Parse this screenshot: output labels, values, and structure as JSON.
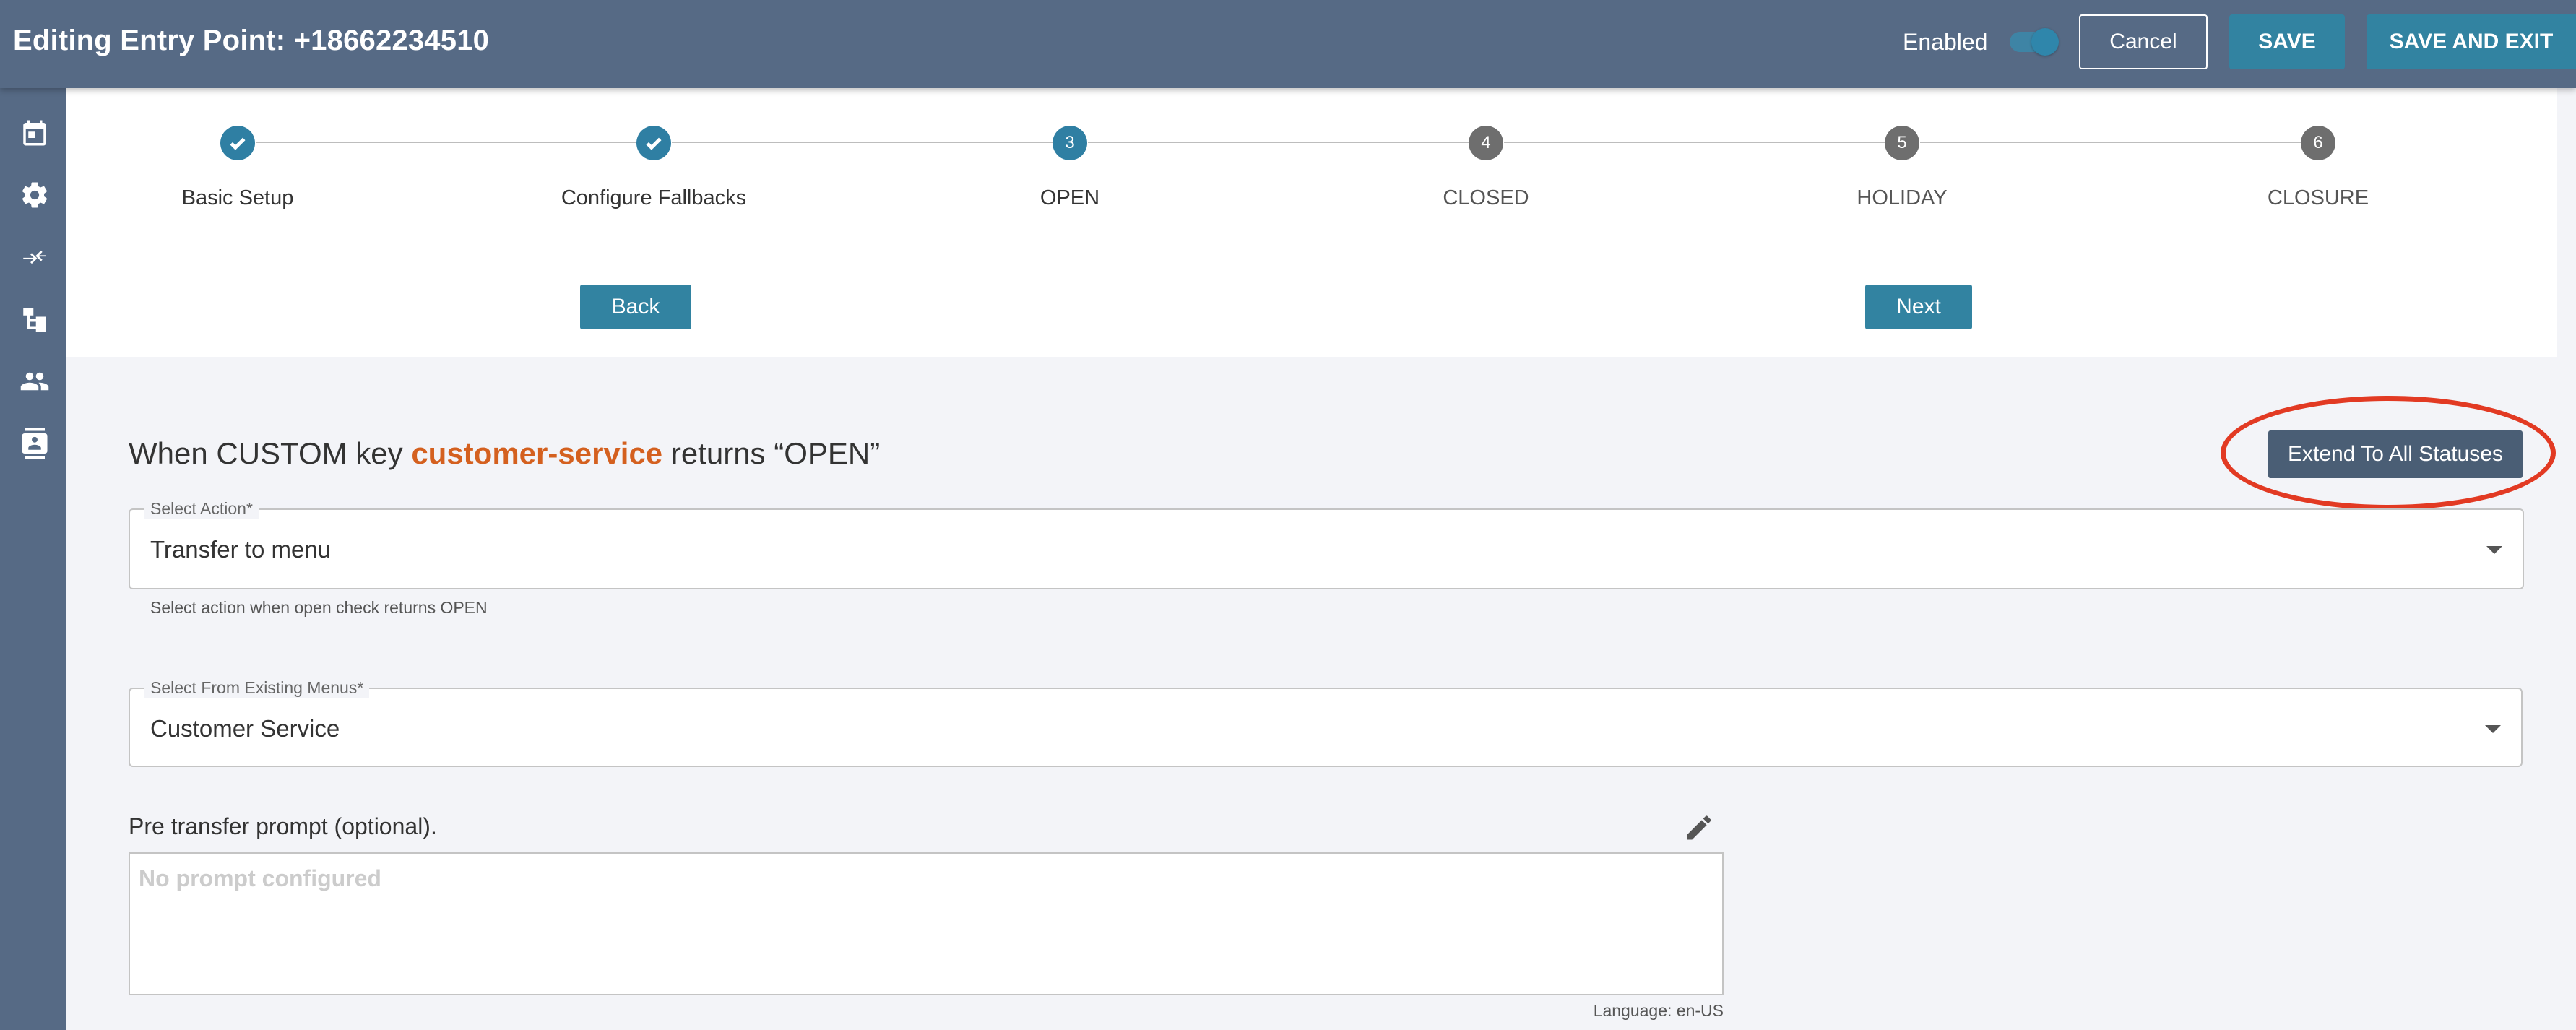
{
  "header": {
    "title": "Editing Entry Point: +18662234510",
    "enabled_label": "Enabled",
    "enabled": true,
    "cancel_label": "Cancel",
    "save_label": "SAVE",
    "save_exit_label": "SAVE AND EXIT"
  },
  "sidebar": {
    "items": [
      {
        "icon": "calendar-icon"
      },
      {
        "icon": "gear-icon"
      },
      {
        "icon": "transfer-arrows-icon"
      },
      {
        "icon": "hierarchy-icon"
      },
      {
        "icon": "people-icon"
      },
      {
        "icon": "contact-card-icon"
      }
    ]
  },
  "stepper": {
    "steps": [
      {
        "number": "1",
        "label": "Basic Setup",
        "state": "done"
      },
      {
        "number": "2",
        "label": "Configure Fallbacks",
        "state": "done"
      },
      {
        "number": "3",
        "label": "OPEN",
        "state": "active"
      },
      {
        "number": "4",
        "label": "CLOSED",
        "state": "pending"
      },
      {
        "number": "5",
        "label": "HOLIDAY",
        "state": "pending"
      },
      {
        "number": "6",
        "label": "CLOSURE",
        "state": "pending"
      }
    ],
    "back_label": "Back",
    "next_label": "Next"
  },
  "section": {
    "heading_prefix": "When CUSTOM key ",
    "heading_key": "customer-service",
    "heading_suffix": " returns “OPEN”",
    "extend_label": "Extend To All Statuses"
  },
  "form": {
    "action": {
      "label": "Select Action*",
      "value": "Transfer to menu",
      "helper": "Select action when open check returns OPEN"
    },
    "menu": {
      "label": "Select From Existing Menus*",
      "value": "Customer Service"
    },
    "prompt": {
      "label": "Pre transfer prompt (optional).",
      "placeholder": "No prompt configured",
      "language": "Language: en-US"
    }
  },
  "colors": {
    "header_bg": "#566a85",
    "primary": "#3283a1",
    "accent_key": "#d4601f",
    "annotation": "#e23a23"
  }
}
